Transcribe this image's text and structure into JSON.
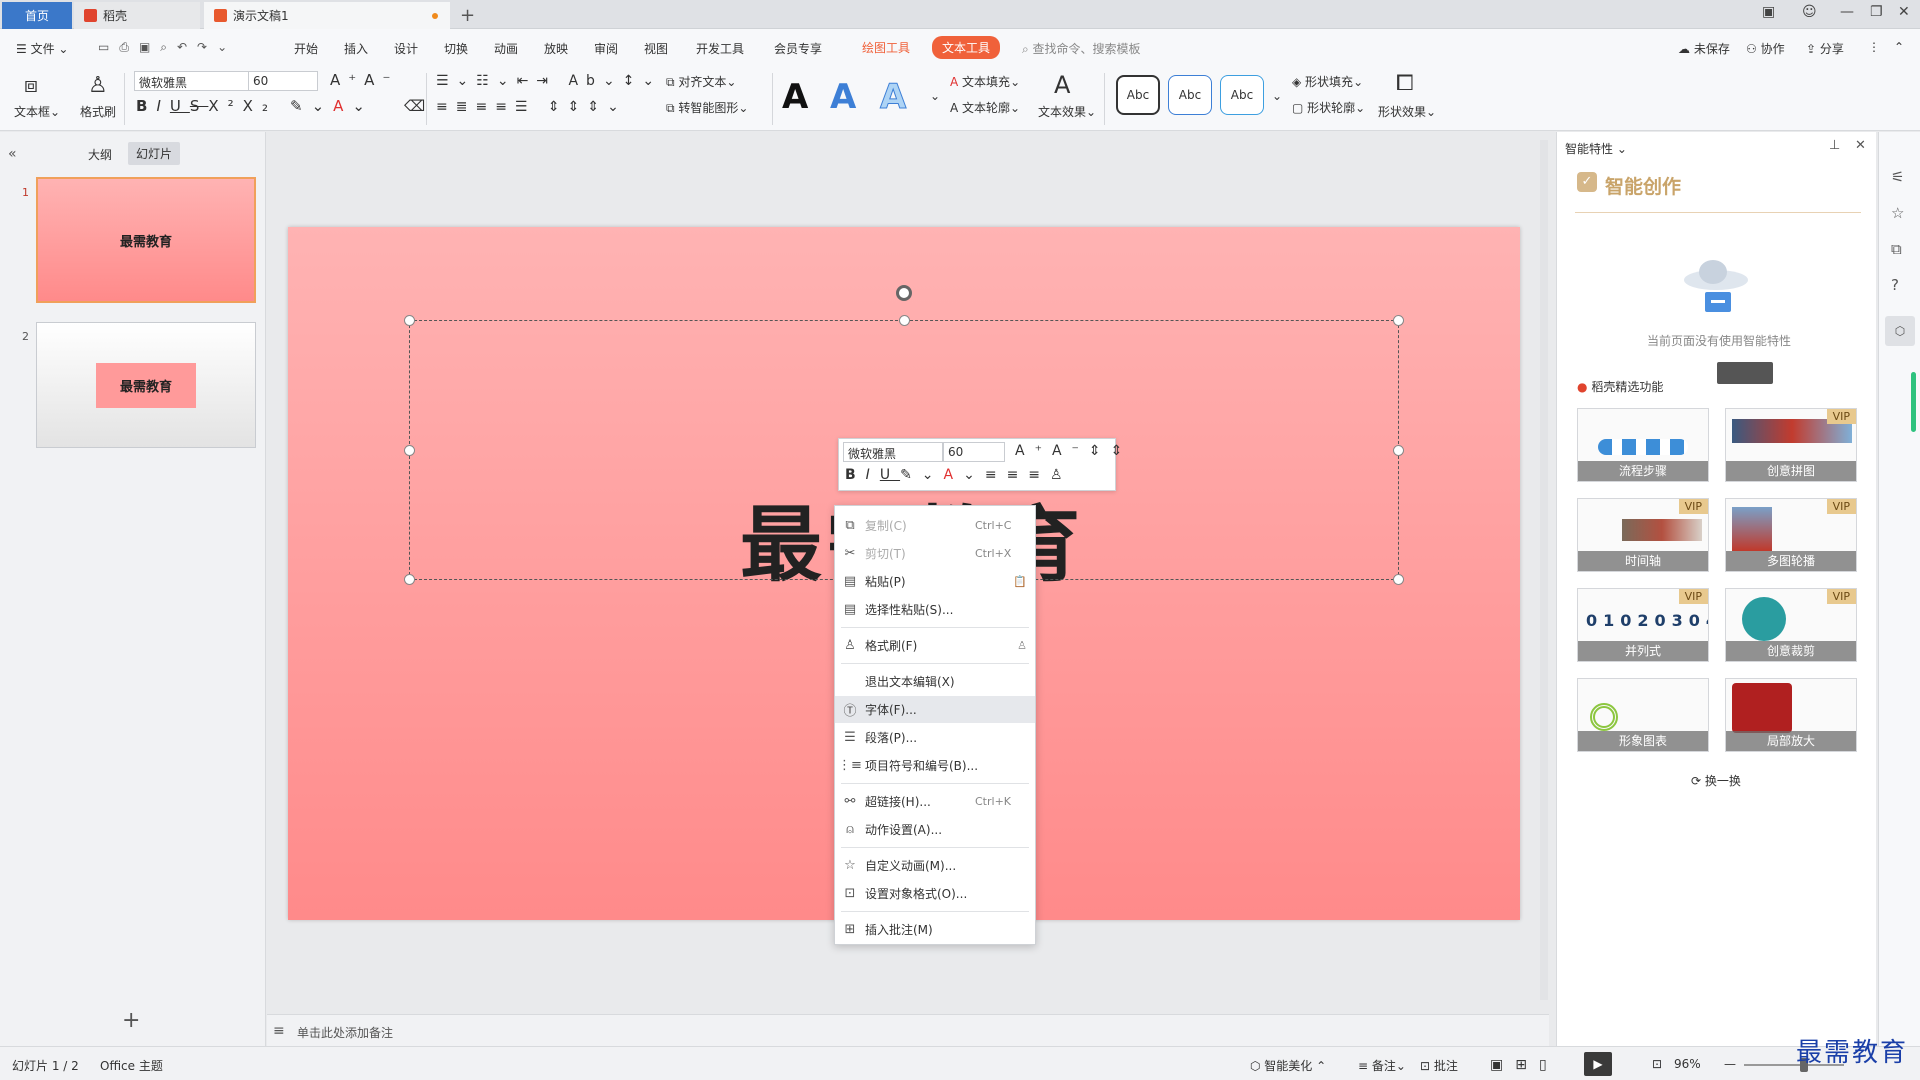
{
  "titlebar": {
    "home": "首页",
    "tab_daoke": "稻壳",
    "tab_doc": "演示文稿1",
    "add": "+"
  },
  "menubar": {
    "file": "文件",
    "items": [
      "开始",
      "插入",
      "设计",
      "切换",
      "动画",
      "放映",
      "审阅",
      "视图",
      "开发工具",
      "会员专享"
    ],
    "drawing_tools": "绘图工具",
    "text_tools": "文本工具",
    "search_placeholder": "查找命令、搜索模板",
    "unsaved": "未保存",
    "collab": "协作",
    "share": "分享"
  },
  "ribbon": {
    "textbox": "文本框",
    "format_painter": "格式刷",
    "font": "微软雅黑",
    "size": "60",
    "align_text": "对齐文本",
    "smart_shape": "转智能图形",
    "text_fill": "文本填充",
    "text_outline": "文本轮廓",
    "text_effect": "文本效果",
    "abc": "Abc",
    "shape_fill": "形状填充",
    "shape_outline": "形状轮廓",
    "shape_effect": "形状效果",
    "bigA": "A"
  },
  "leftpanel": {
    "tab_outline": "大纲",
    "tab_slides": "幻灯片",
    "slides": [
      {
        "num": "1",
        "text": "最需教育"
      },
      {
        "num": "2",
        "text": "最需教育"
      }
    ],
    "add": "+"
  },
  "slide": {
    "text": "最需教育"
  },
  "minitoolbar": {
    "font": "微软雅黑",
    "size": "60"
  },
  "context_menu": [
    {
      "label": "复制(C)",
      "shortcut": "Ctrl+C",
      "icon": "copy-icon",
      "disabled": true
    },
    {
      "label": "剪切(T)",
      "shortcut": "Ctrl+X",
      "icon": "cut-icon",
      "disabled": true
    },
    {
      "label": "粘贴(P)",
      "shortcut": "",
      "icon": "paste-icon"
    },
    {
      "label": "选择性粘贴(S)...",
      "shortcut": "",
      "icon": "paste-special-icon"
    },
    {
      "label": "格式刷(F)",
      "shortcut": "",
      "icon": "format-painter-icon"
    },
    {
      "label": "退出文本编辑(X)",
      "shortcut": "",
      "icon": ""
    },
    {
      "label": "字体(F)...",
      "shortcut": "",
      "icon": "font-icon",
      "highlight": true
    },
    {
      "label": "段落(P)...",
      "shortcut": "",
      "icon": "paragraph-icon"
    },
    {
      "label": "项目符号和编号(B)...",
      "shortcut": "",
      "icon": "bullets-icon"
    },
    {
      "label": "超链接(H)...",
      "shortcut": "Ctrl+K",
      "icon": "link-icon"
    },
    {
      "label": "动作设置(A)...",
      "shortcut": "",
      "icon": "action-icon"
    },
    {
      "label": "自定义动画(M)...",
      "shortcut": "",
      "icon": "animation-icon"
    },
    {
      "label": "设置对象格式(O)...",
      "shortcut": "",
      "icon": "object-format-icon"
    },
    {
      "label": "插入批注(M)",
      "shortcut": "",
      "icon": "comment-icon"
    }
  ],
  "notes": {
    "placeholder": "单击此处添加备注"
  },
  "rightpanel": {
    "header": "智能特性",
    "title": "智能创作",
    "empty_text": "当前页面没有使用智能特性",
    "section": "稻壳精选功能",
    "cards": [
      {
        "label": "流程步骤",
        "vip": false
      },
      {
        "label": "创意拼图",
        "vip": true
      },
      {
        "label": "时间轴",
        "vip": true
      },
      {
        "label": "多图轮播",
        "vip": true
      },
      {
        "label": "并列式",
        "vip": true
      },
      {
        "label": "创意裁剪",
        "vip": true
      },
      {
        "label": "形象图表",
        "vip": false
      },
      {
        "label": "局部放大",
        "vip": false
      }
    ],
    "vip_label": "VIP",
    "refresh": "换一换"
  },
  "statusbar": {
    "slide_info": "幻灯片 1 / 2",
    "theme": "Office 主题",
    "beautify": "智能美化",
    "notes": "备注",
    "comments": "批注",
    "zoom": "96%"
  },
  "watermark": "最需教育",
  "colors": {
    "accent": "#3b78c9",
    "text_tools": "#f0613a",
    "slide_top": "#ffb3b3",
    "slide_bottom": "#ff8a8a"
  }
}
